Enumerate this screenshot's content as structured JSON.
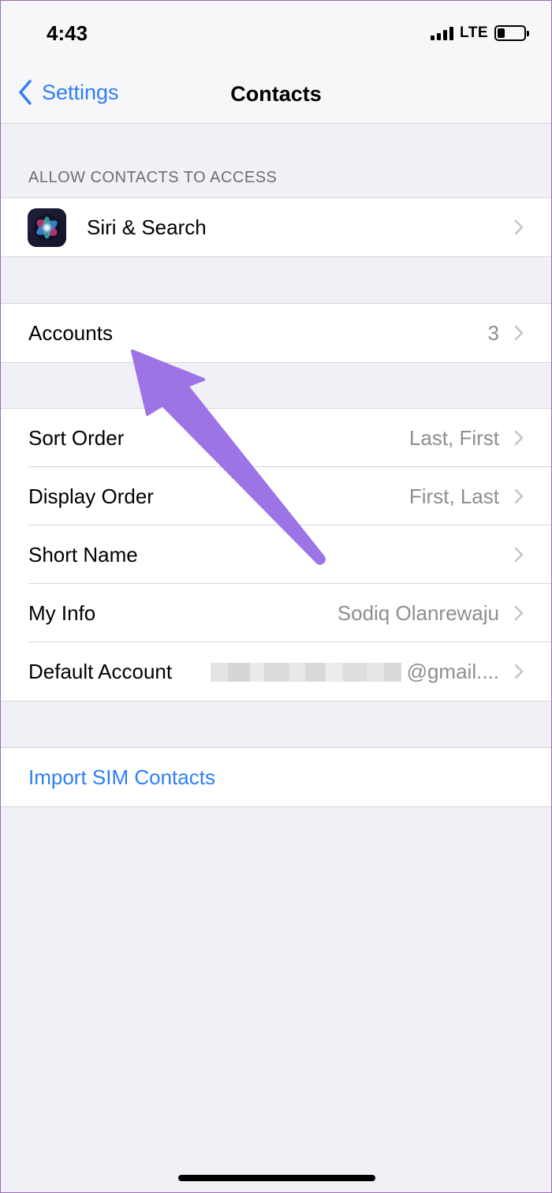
{
  "status_bar": {
    "time": "4:43",
    "network": "LTE"
  },
  "nav": {
    "back_label": "Settings",
    "title": "Contacts"
  },
  "sections": {
    "access_header": "ALLOW CONTACTS TO ACCESS",
    "siri": {
      "label": "Siri & Search"
    },
    "accounts": {
      "label": "Accounts",
      "value": "3"
    },
    "sort_order": {
      "label": "Sort Order",
      "value": "Last, First"
    },
    "display_order": {
      "label": "Display Order",
      "value": "First, Last"
    },
    "short_name": {
      "label": "Short Name"
    },
    "my_info": {
      "label": "My Info",
      "value": "Sodiq Olanrewaju"
    },
    "default_account": {
      "label": "Default Account",
      "value": "@gmail...."
    },
    "import_sim": {
      "label": "Import SIM Contacts"
    }
  },
  "colors": {
    "accent": "#2f7ff6",
    "annotation_arrow": "#9d74e6",
    "background": "#f1f0f6"
  }
}
